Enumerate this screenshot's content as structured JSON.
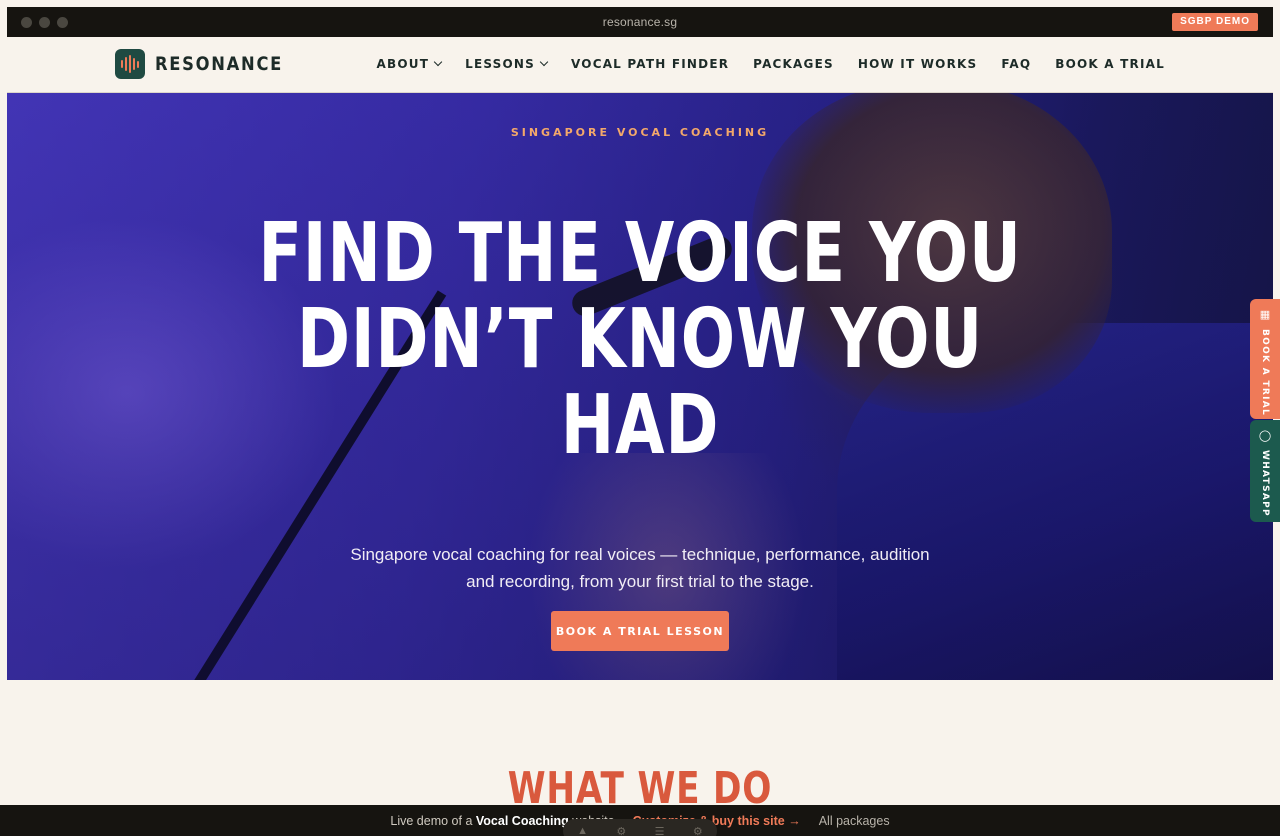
{
  "browser": {
    "url": "resonance.sg",
    "demo_badge": "SGBP DEMO"
  },
  "brand": {
    "name": "RESONANCE",
    "colors": {
      "accent": "#ef7a58",
      "dark_green": "#1f4a42",
      "cream": "#f8f3ec"
    }
  },
  "nav": {
    "items": [
      {
        "label": "ABOUT",
        "has_dropdown": true
      },
      {
        "label": "LESSONS",
        "has_dropdown": true
      },
      {
        "label": "VOCAL PATH FINDER",
        "has_dropdown": false
      },
      {
        "label": "PACKAGES",
        "has_dropdown": false
      },
      {
        "label": "HOW IT WORKS",
        "has_dropdown": false
      },
      {
        "label": "FAQ",
        "has_dropdown": false
      },
      {
        "label": "BOOK A TRIAL",
        "has_dropdown": false
      }
    ]
  },
  "hero": {
    "eyebrow": "SINGAPORE VOCAL COACHING",
    "headline_line1": "FIND THE VOICE YOU",
    "headline_line2": "DIDN’T KNOW YOU",
    "headline_line3": "HAD",
    "subtitle": "Singapore vocal coaching for real voices — technique, performance, audition and recording, from your first trial to the stage.",
    "cta": "BOOK A TRIAL LESSON"
  },
  "side_tabs": {
    "book": {
      "label": "BOOK A TRIAL",
      "icon": "calendar-icon"
    },
    "whatsapp": {
      "label": "WHATSAPP",
      "icon": "chat-bubble-icon"
    }
  },
  "section": {
    "title": "WHAT WE DO"
  },
  "bottom_bar": {
    "prefix": "Live demo of a",
    "site_type": "Vocal Coaching",
    "suffix": "website",
    "link": "Customize & buy this site →",
    "all_packages": "All packages"
  }
}
